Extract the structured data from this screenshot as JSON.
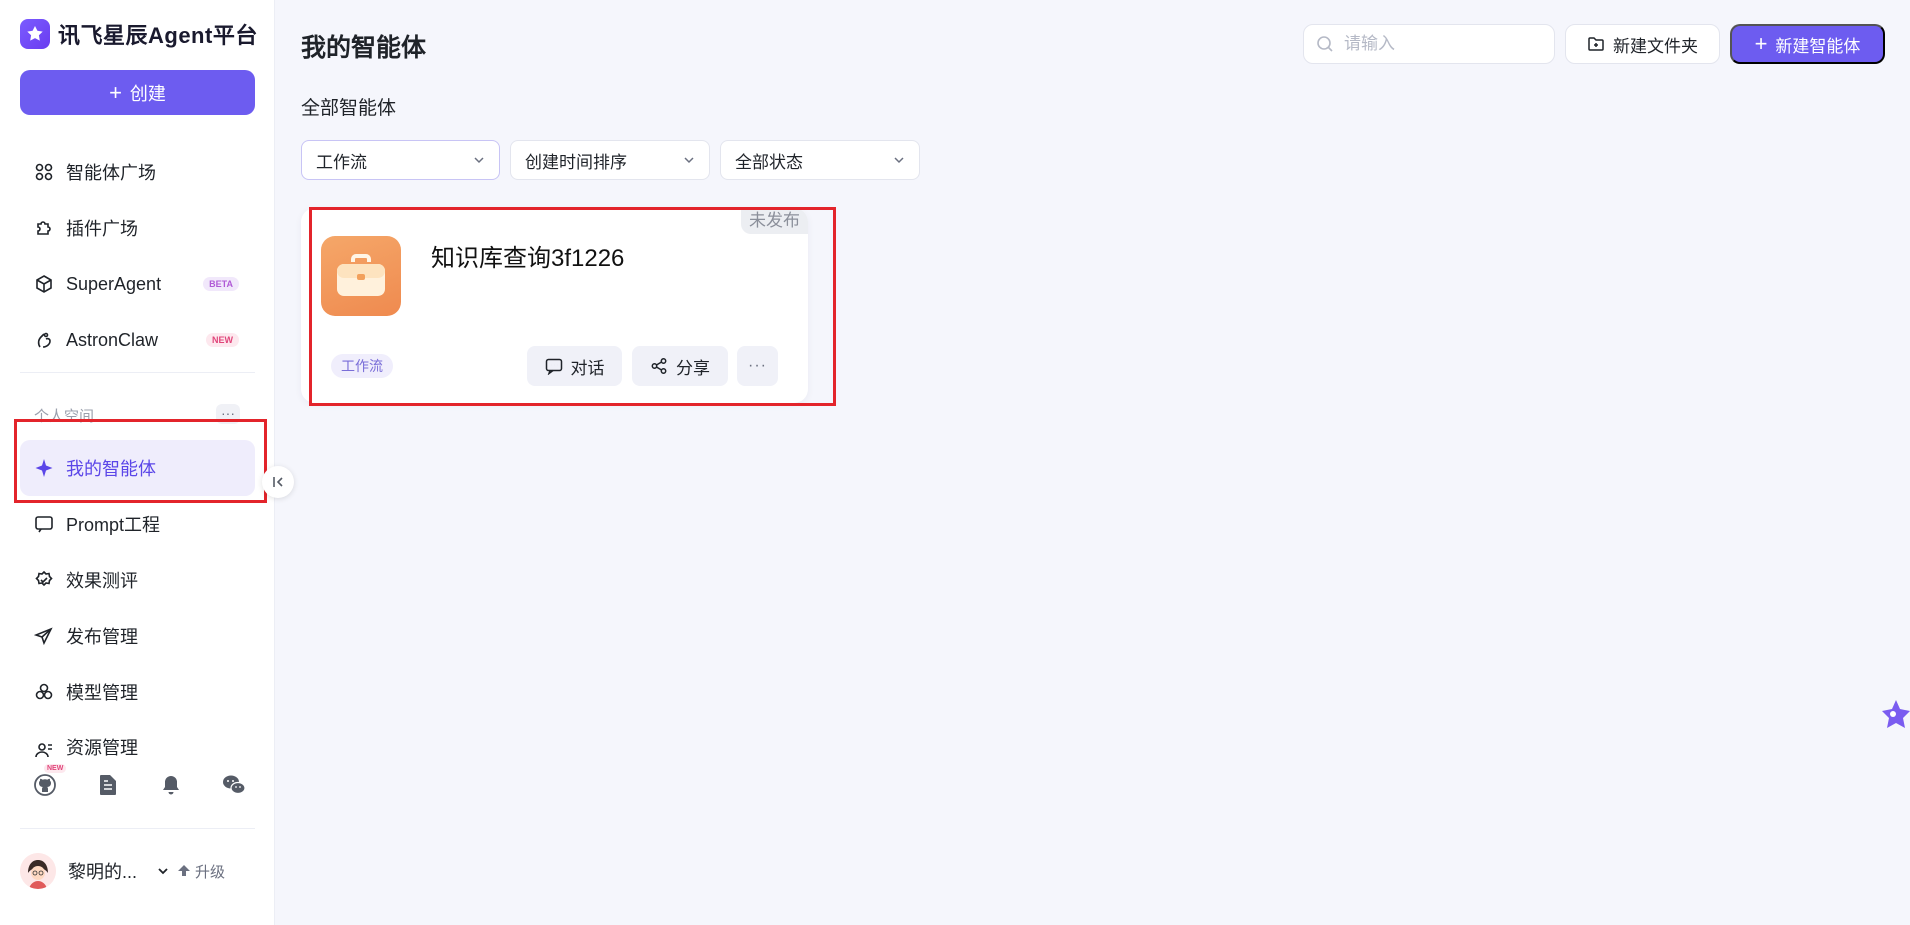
{
  "app": {
    "title": "讯飞星辰Agent平台"
  },
  "sidebar": {
    "create_label": "创建",
    "nav": [
      {
        "label": "智能体广场"
      },
      {
        "label": "插件广场"
      },
      {
        "label": "SuperAgent",
        "badge": "BETA"
      },
      {
        "label": "AstronClaw",
        "badge": "NEW"
      }
    ],
    "section_label": "个人空间",
    "section_more": "···",
    "workspace": [
      {
        "label": "我的智能体",
        "active": true
      },
      {
        "label": "Prompt工程"
      },
      {
        "label": "效果测评"
      },
      {
        "label": "发布管理"
      },
      {
        "label": "模型管理"
      },
      {
        "label": "资源管理"
      }
    ],
    "bottom_icons": [
      "github-icon",
      "document-icon",
      "bell-icon",
      "wechat-icon"
    ],
    "bottom_new_badge": "NEW",
    "user": {
      "name": "黎明的...",
      "upgrade_label": "升级"
    }
  },
  "header": {
    "title": "我的智能体",
    "search_placeholder": "请输入",
    "new_folder_label": "新建文件夹",
    "new_agent_label": "新建智能体"
  },
  "main": {
    "section_title": "全部智能体",
    "filters": [
      {
        "value": "工作流"
      },
      {
        "value": "创建时间排序"
      },
      {
        "value": "全部状态"
      }
    ],
    "cards": [
      {
        "title": "知识库查询3f1226",
        "status": "未发布",
        "type": "工作流",
        "chat_label": "对话",
        "share_label": "分享",
        "more_label": "···"
      }
    ]
  },
  "colors": {
    "accent": "#6d5cf0",
    "highlight_box": "#e3242b",
    "active_bg": "#efedfc"
  }
}
